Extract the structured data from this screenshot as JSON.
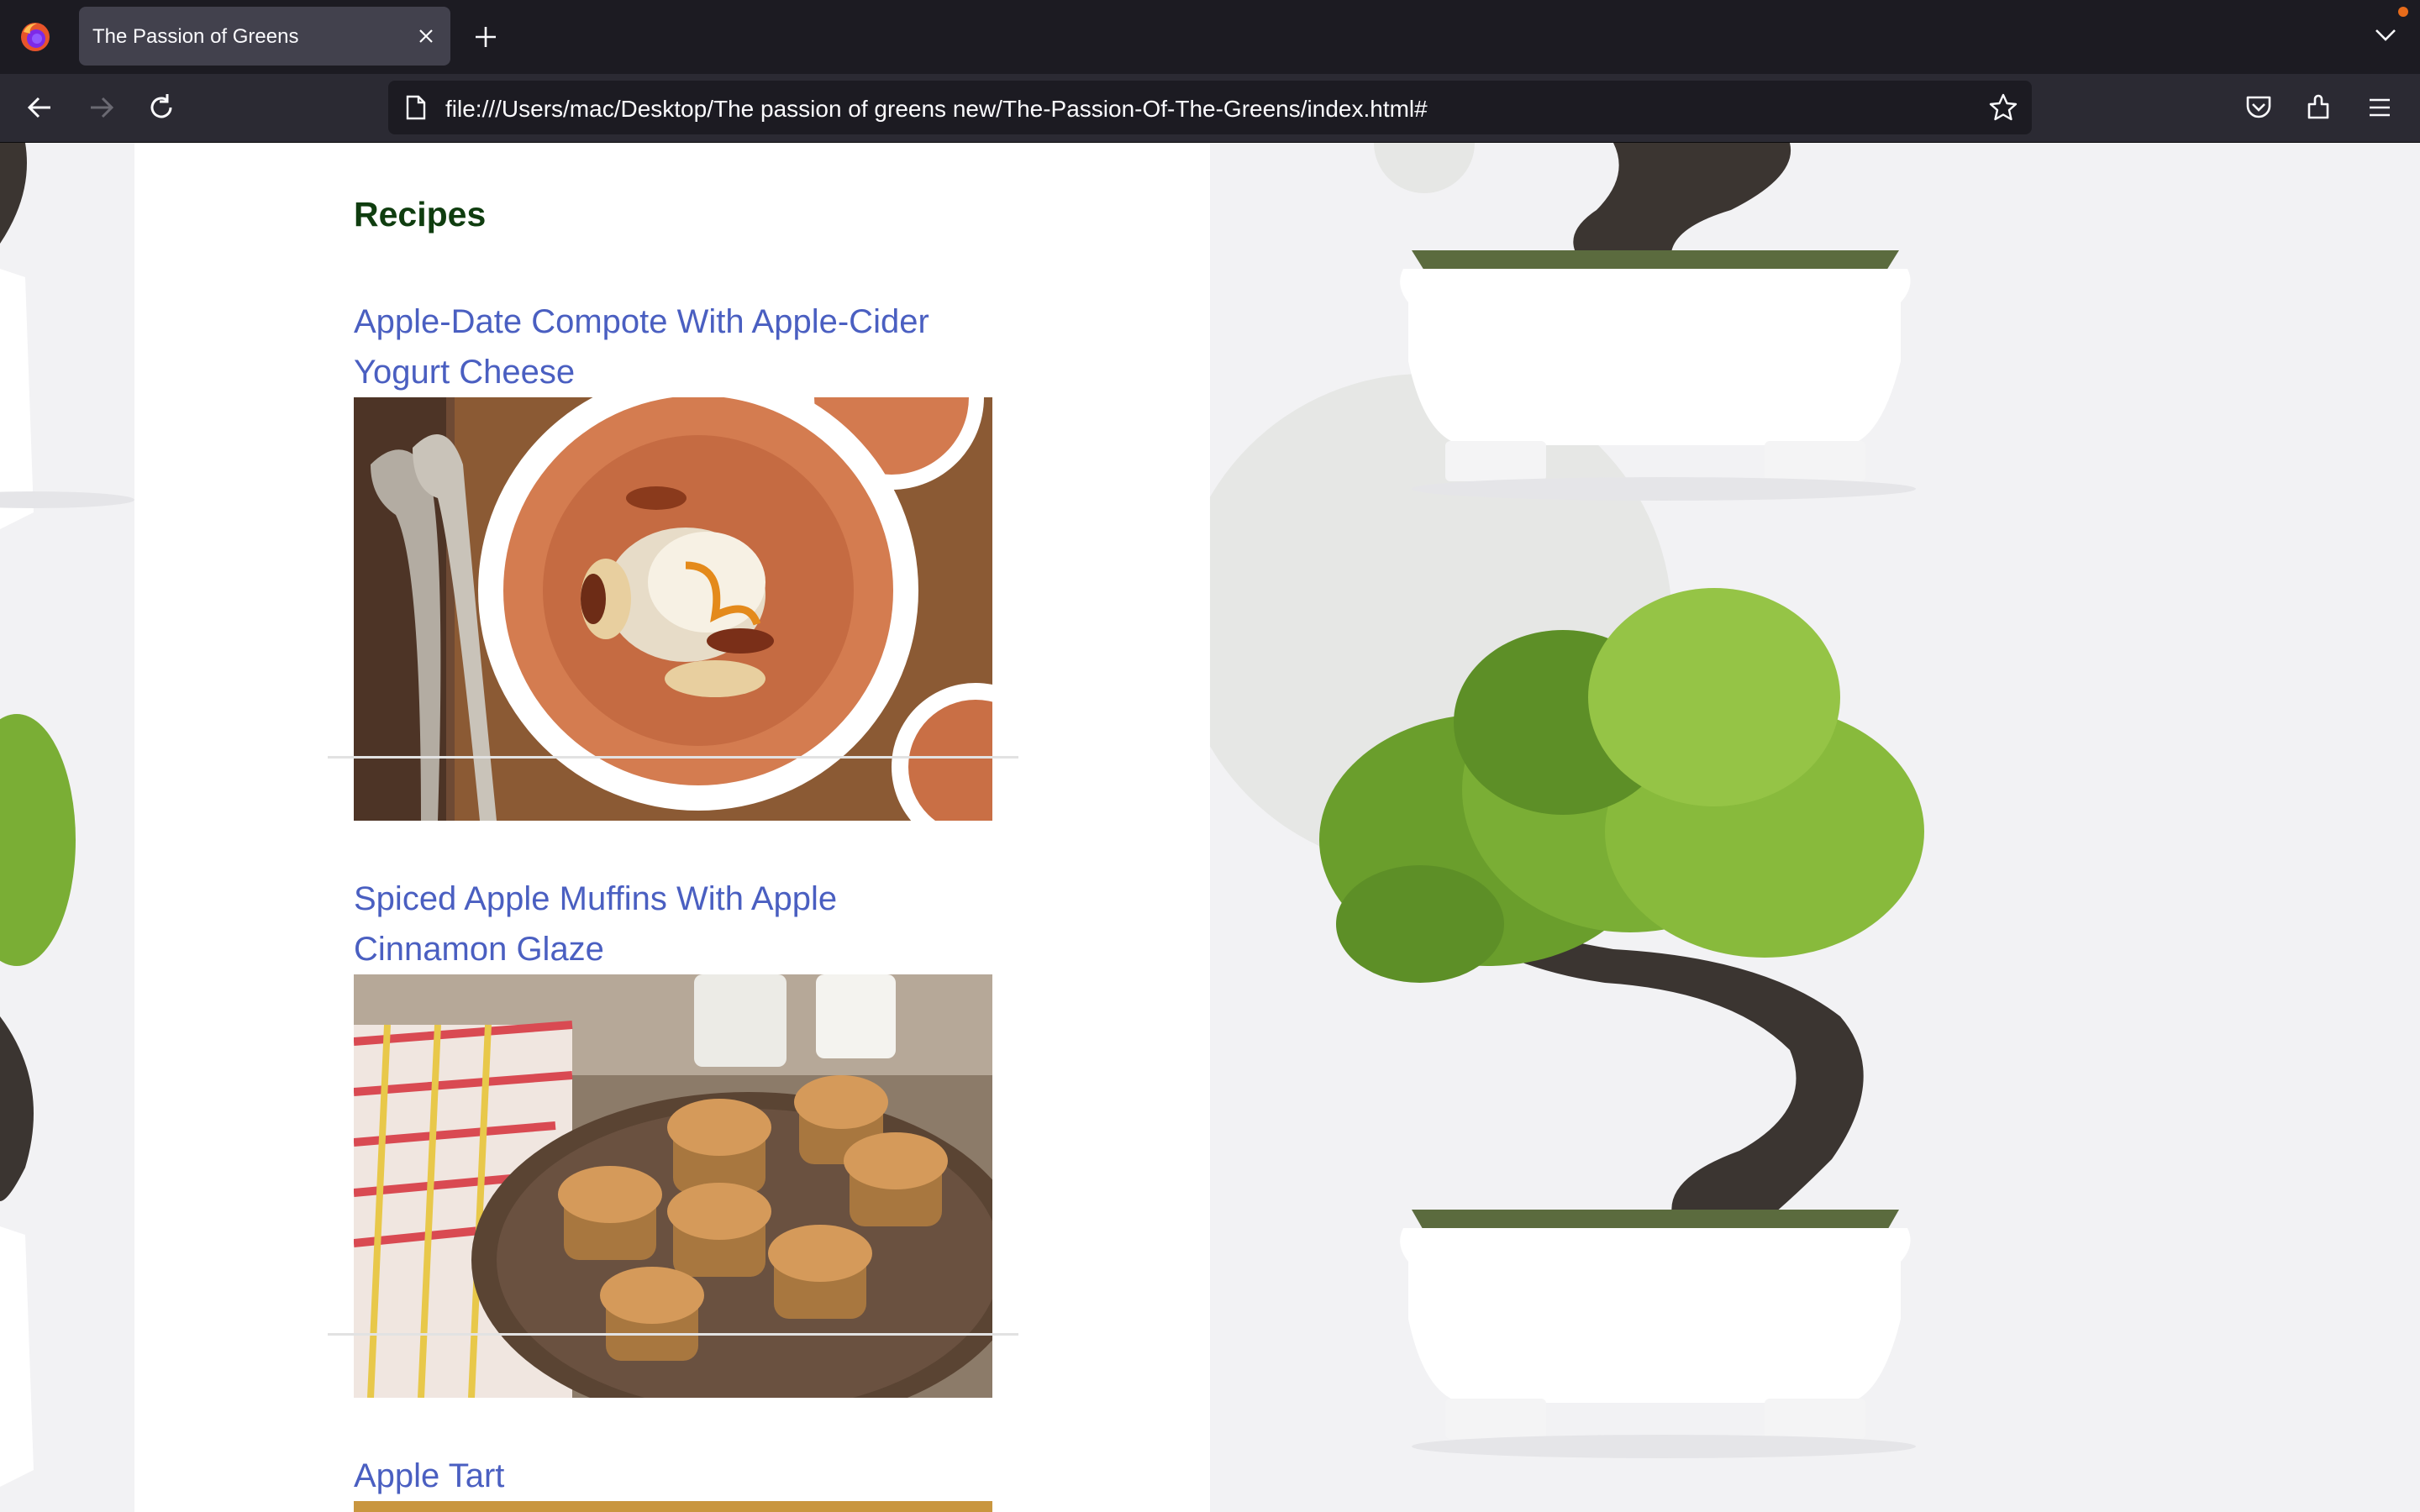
{
  "browser": {
    "tab_title": "The Passion of Greens",
    "url": "file:///Users/mac/Desktop/The passion of greens new/The-Passion-Of-The-Greens/index.html#"
  },
  "page": {
    "section_heading": "Recipes",
    "recipes": [
      {
        "title": "Apple-Date Compote With Apple-Cider Yogurt Cheese"
      },
      {
        "title": "Spiced Apple Muffins With Apple Cinnamon Glaze"
      },
      {
        "title": "Apple Tart"
      }
    ]
  },
  "colors": {
    "heading": "#0f3d0f",
    "link": "#4a5fc1",
    "page_background": "#f2f2f4",
    "browser_chrome": "#1c1b22"
  }
}
